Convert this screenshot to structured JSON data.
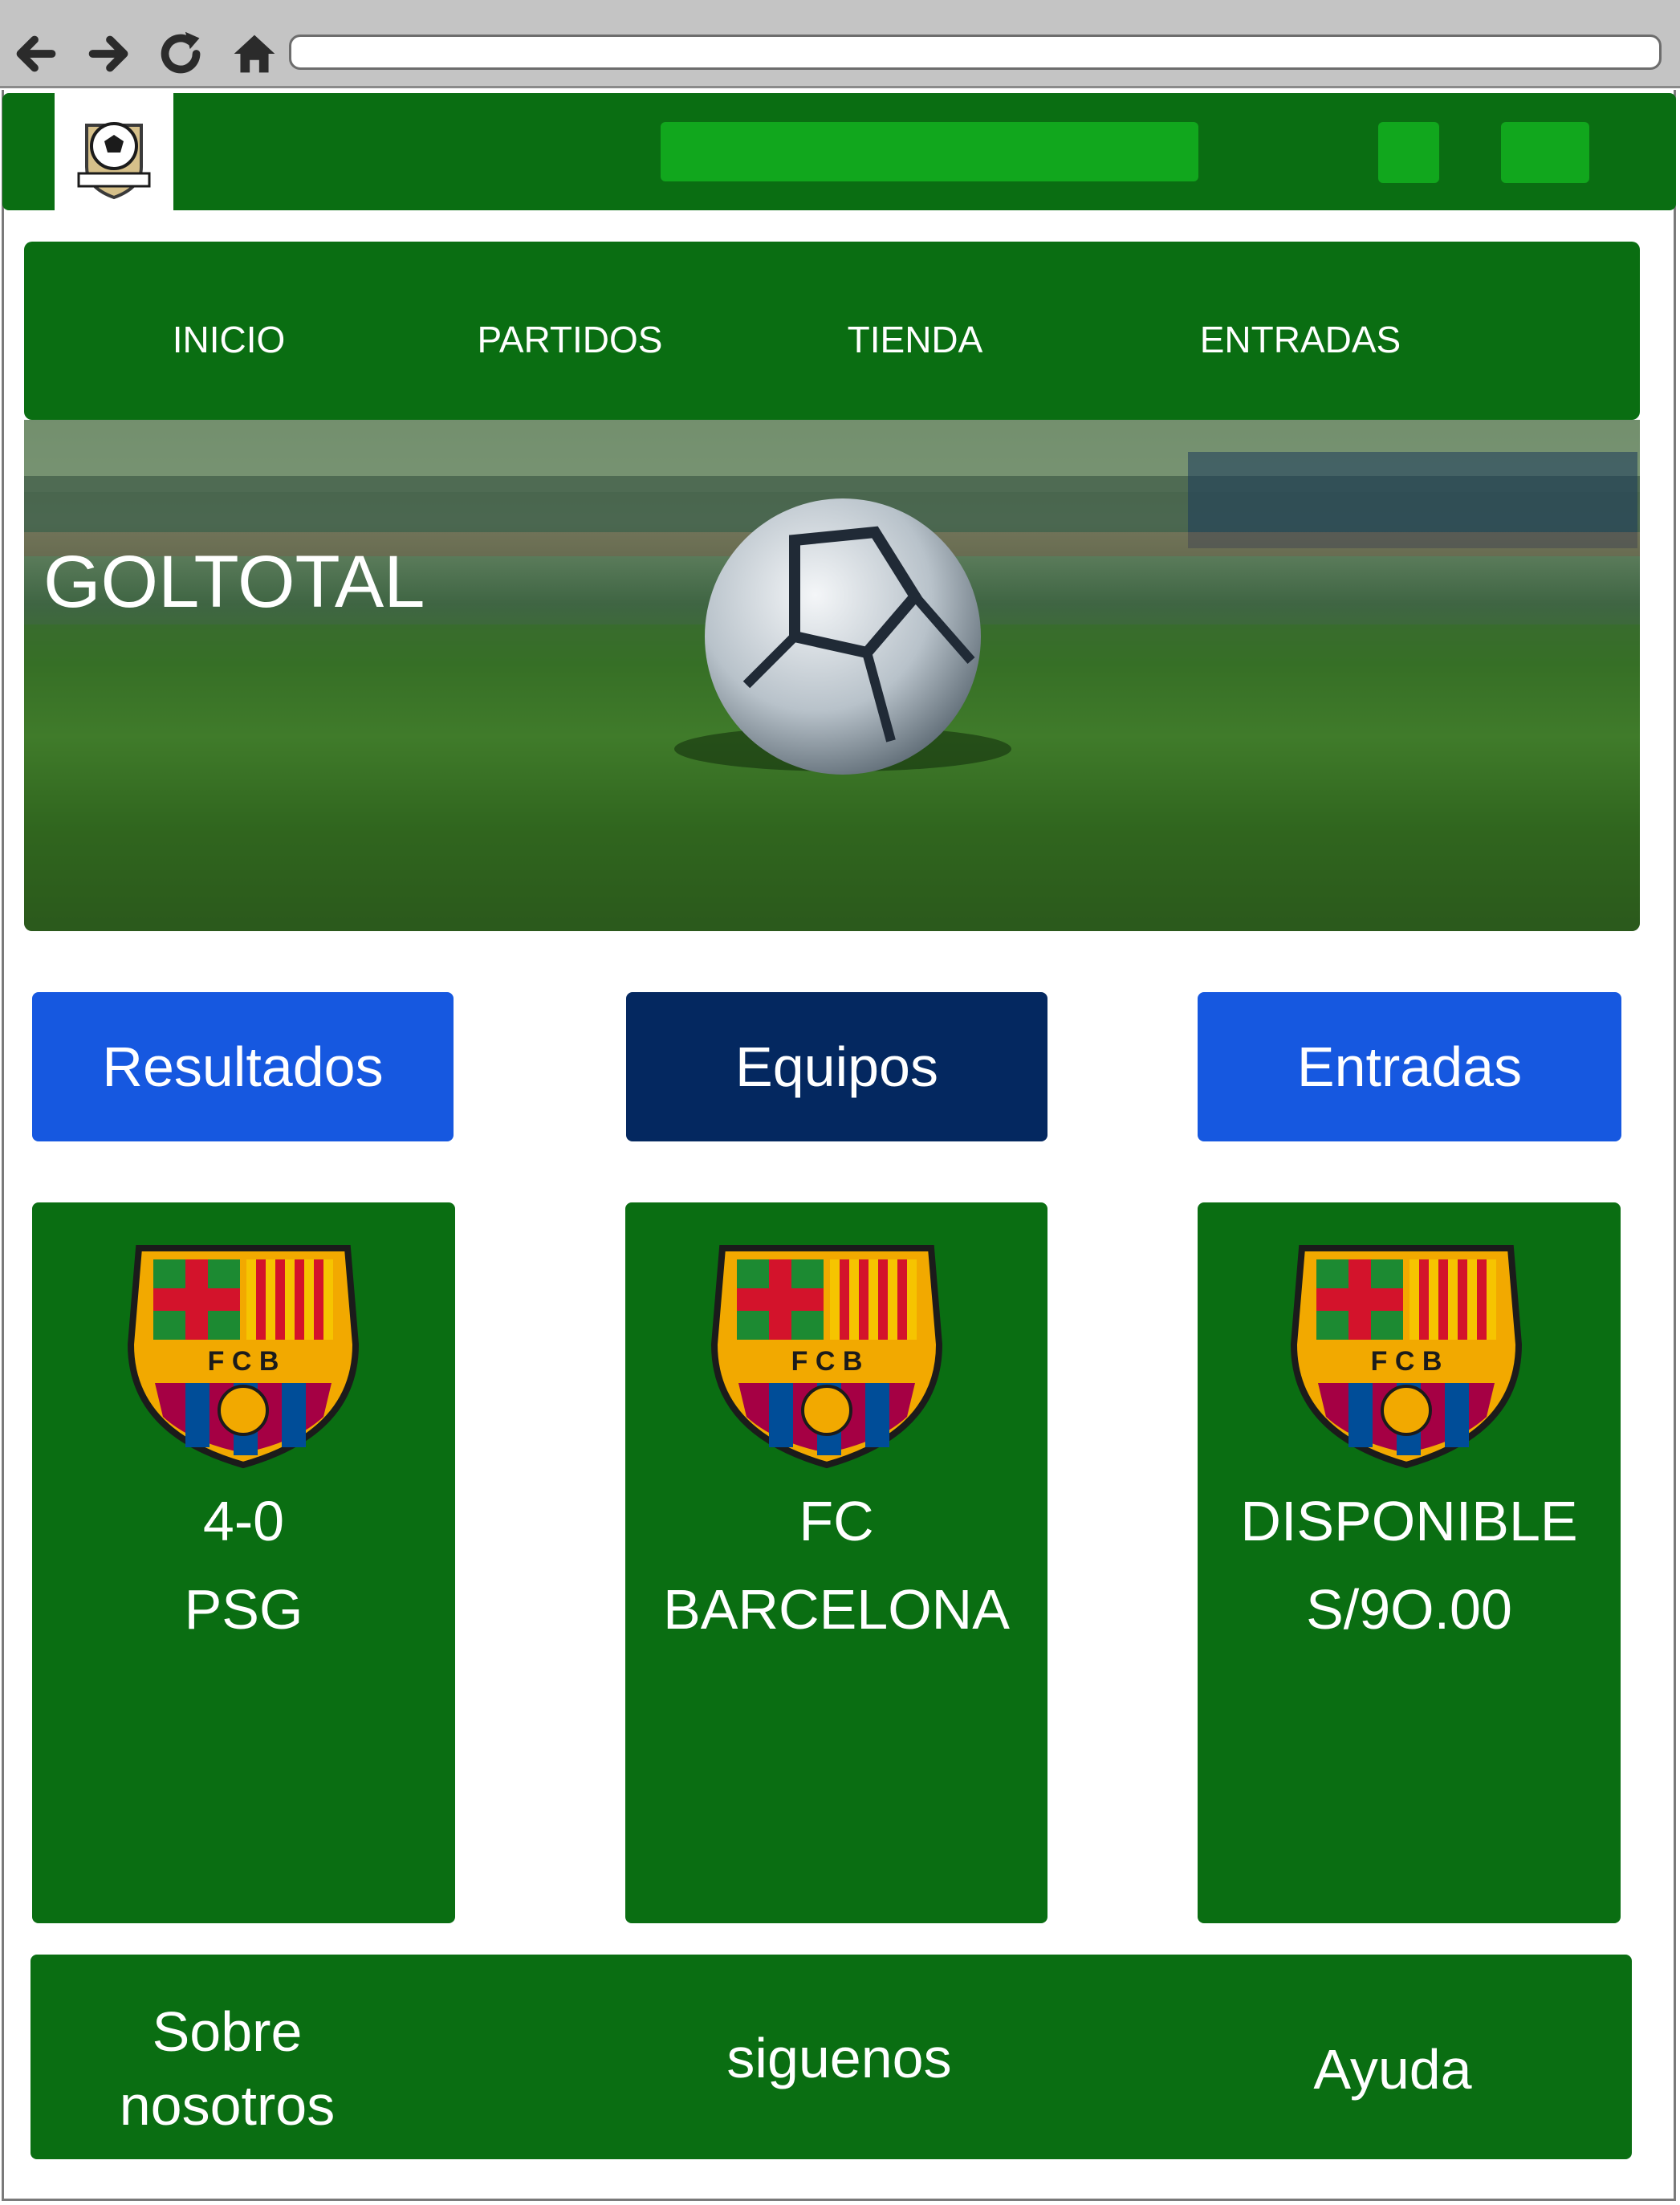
{
  "browser": {
    "back_icon": "arrow-left-icon",
    "forward_icon": "arrow-right-icon",
    "reload_icon": "reload-icon",
    "home_icon": "home-icon",
    "address_value": ""
  },
  "header": {
    "logo_icon": "soccer-ball-crest-icon",
    "colors": {
      "bar": "#0a6e12",
      "accent": "#11a71d"
    }
  },
  "nav": {
    "items": [
      {
        "label": "INICIO"
      },
      {
        "label": "PARTIDOS"
      },
      {
        "label": "TIENDA"
      },
      {
        "label": "ENTRADAS"
      }
    ]
  },
  "hero": {
    "title": "GOLTOTAL",
    "image": "soccer-ball-on-grass"
  },
  "buttons": [
    {
      "label": "Resultados",
      "color": "#1658e0"
    },
    {
      "label": "Equipos",
      "color": "#042860"
    },
    {
      "label": "Entradas",
      "color": "#1658e0"
    }
  ],
  "cards": [
    {
      "crest_icon": "fc-barcelona-crest-icon",
      "line1": "4-0",
      "line2": "PSG"
    },
    {
      "crest_icon": "fc-barcelona-crest-icon",
      "line1": "FC",
      "line2": "BARCELONA"
    },
    {
      "crest_icon": "fc-barcelona-crest-icon",
      "line1": "DISPONIBLE",
      "line2": "S/9O.00"
    }
  ],
  "footer": {
    "items": [
      {
        "line1": "Sobre",
        "line2": "nosotros"
      },
      {
        "line1": "siguenos"
      },
      {
        "line1": "Ayuda"
      }
    ]
  }
}
